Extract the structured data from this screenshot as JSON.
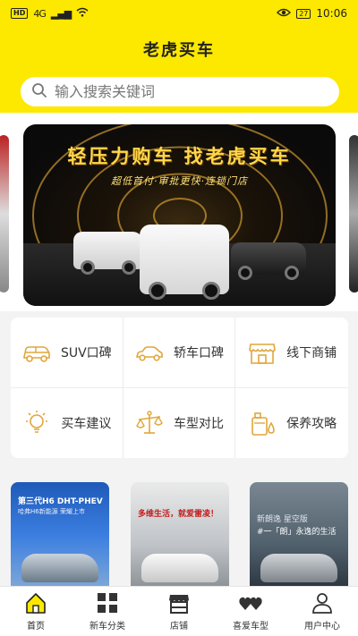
{
  "status_bar": {
    "hd": "HD",
    "signal": "4G",
    "battery": "27",
    "time": "10:06"
  },
  "header": {
    "title": "老虎买车"
  },
  "search": {
    "placeholder": "输入搜索关键词"
  },
  "banner": {
    "headline": "轻压力购车 找老虎买车",
    "subline": "超低首付·审批更快·连锁门店"
  },
  "menu": [
    {
      "label": "SUV口碑",
      "icon": "suv-icon"
    },
    {
      "label": "轿车口碑",
      "icon": "sedan-icon"
    },
    {
      "label": "线下商铺",
      "icon": "store-icon"
    },
    {
      "label": "买车建议",
      "icon": "bulb-icon"
    },
    {
      "label": "车型对比",
      "icon": "scale-icon"
    },
    {
      "label": "保养攻略",
      "icon": "oil-icon"
    }
  ],
  "cards": [
    {
      "line1": "第三代H6 DHT-PHEV",
      "line2": "哈弗H6新能源 荣耀上市"
    },
    {
      "line1": "多维生活，就爱雷凌！",
      "line2": ""
    },
    {
      "line1": "新朗逸 星空版",
      "line2": "#一「朗」永逸的生活"
    }
  ],
  "nav": [
    {
      "label": "首页",
      "icon": "home-icon",
      "active": true
    },
    {
      "label": "新车分类",
      "icon": "grid-icon"
    },
    {
      "label": "店铺",
      "icon": "shop-icon"
    },
    {
      "label": "喜爱车型",
      "icon": "hearts-icon"
    },
    {
      "label": "用户中心",
      "icon": "user-icon"
    }
  ],
  "colors": {
    "accent": "#fde800",
    "icon_stroke": "#e0a63a"
  }
}
